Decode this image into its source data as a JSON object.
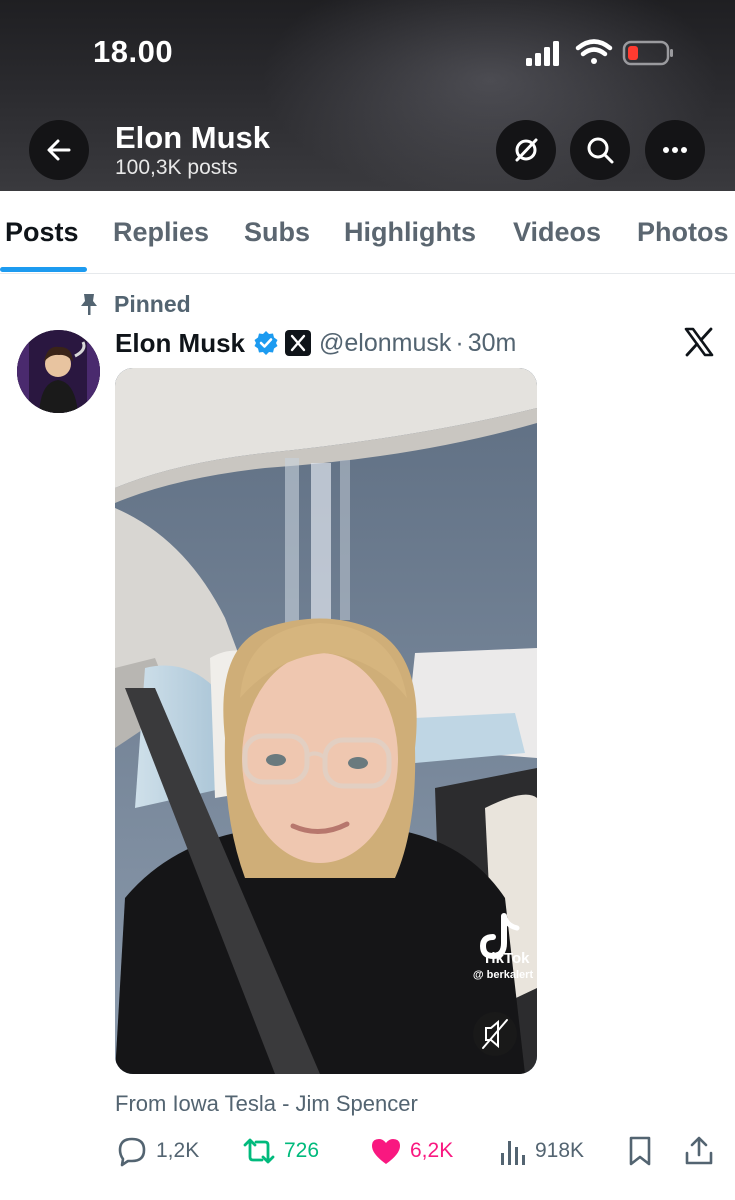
{
  "status_bar": {
    "time": "18.00"
  },
  "header": {
    "name": "Elon Musk",
    "post_count": "100,3K posts",
    "buttons": [
      "back-arrow-icon",
      "grok-icon",
      "search-icon",
      "more-icon"
    ]
  },
  "tabs": [
    {
      "label": "Posts",
      "active": true
    },
    {
      "label": "Replies",
      "active": false
    },
    {
      "label": "Subs",
      "active": false
    },
    {
      "label": "Highlights",
      "active": false
    },
    {
      "label": "Videos",
      "active": false
    },
    {
      "label": "Photos",
      "active": false
    }
  ],
  "post": {
    "pinned_label": "Pinned",
    "author_name": "Elon Musk",
    "handle": "@elonmusk",
    "separator": "·",
    "time": "30m",
    "media": {
      "watermark_name": "TikTok",
      "watermark_handle": "@ berkalert"
    },
    "caption": "From Iowa Tesla - Jim Spencer",
    "stats": {
      "replies": "1,2K",
      "reposts": "726",
      "likes": "6,2K",
      "views": "918K"
    }
  },
  "colors": {
    "accent": "#1d9bf0",
    "repost": "#00ba7c",
    "like": "#f91880",
    "muted": "#536471",
    "text": "#0f1419"
  }
}
